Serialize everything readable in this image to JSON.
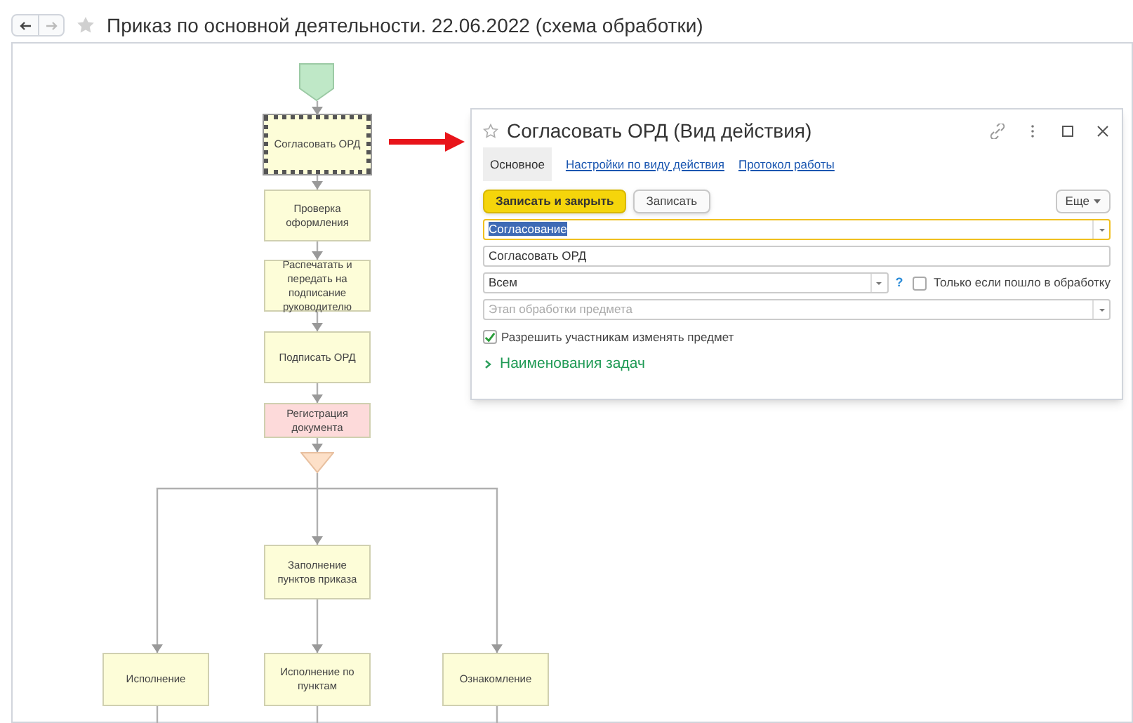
{
  "window": {
    "title": "Приказ по основной деятельности. 22.06.2022 (схема обработки)",
    "back_enabled": true,
    "forward_enabled": false
  },
  "diagram": {
    "nodes": [
      {
        "kind": "start"
      },
      {
        "kind": "task",
        "label": "Согласовать ОРД",
        "selected": true,
        "color": "#fdfdd8"
      },
      {
        "kind": "task",
        "label": "Проверка оформления",
        "selected": false,
        "color": "#fdfdd8"
      },
      {
        "kind": "task",
        "label": "Распечатать и передать на подписание руководителю",
        "selected": false,
        "color": "#fdfdd8"
      },
      {
        "kind": "task",
        "label": "Подписать ОРД",
        "selected": false,
        "color": "#fdfdd8"
      },
      {
        "kind": "task",
        "label": "Регистрация документа",
        "selected": false,
        "color": "#fddada"
      },
      {
        "kind": "split"
      },
      {
        "kind": "task",
        "label": "Заполнение пунктов приказа",
        "selected": false,
        "color": "#fdfdd8"
      },
      {
        "kind": "task",
        "label": "Исполнение",
        "selected": false,
        "color": "#fdfdd8"
      },
      {
        "kind": "task",
        "label": "Исполнение по пунктам",
        "selected": false,
        "color": "#fdfdd8"
      },
      {
        "kind": "task",
        "label": "Ознакомление",
        "selected": false,
        "color": "#fdfdd8"
      }
    ]
  },
  "dialog": {
    "title": "Согласовать ОРД (Вид действия)",
    "tabs": [
      {
        "label": "Основное",
        "selected": true
      },
      {
        "label": "Настройки по виду действия",
        "selected": false
      },
      {
        "label": "Протокол работы",
        "selected": false
      }
    ],
    "buttons": [
      {
        "label": "Записать и закрыть",
        "kind": "primary"
      },
      {
        "label": "Записать",
        "kind": "plain"
      }
    ],
    "more_button": "Еще",
    "fields": [
      {
        "kind": "dropdown",
        "value": "Согласование",
        "focused": true,
        "selected_text": true
      },
      {
        "kind": "text",
        "value": "Согласовать ОРД",
        "focused": false,
        "selected_text": false
      },
      {
        "kind": "dropdown_help",
        "value": "Всем",
        "focused": false,
        "selected_text": false,
        "help": "?",
        "checkbox": {
          "label": "Только если пошло в обработку",
          "checked": false
        }
      },
      {
        "kind": "dropdown",
        "placeholder": "Этап обработки предмета",
        "focused": false
      }
    ],
    "checkbox": {
      "label": "Разрешить участникам изменять предмет",
      "checked": true
    },
    "group": {
      "label": "Наименования задач",
      "expanded": false
    }
  }
}
